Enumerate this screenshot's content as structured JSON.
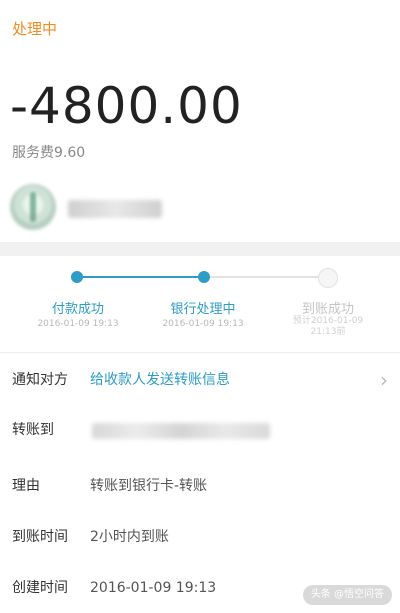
{
  "header": {
    "status": "处理中"
  },
  "amount": {
    "value": "-4800.00",
    "fee": "服务费9.60"
  },
  "progress": {
    "steps": [
      {
        "label": "付款成功",
        "time": "2016-01-09 19:13",
        "state": "done"
      },
      {
        "label": "银行处理中",
        "time": "2016-01-09 19:13",
        "state": "current"
      },
      {
        "label": "到账成功",
        "time": "预计2016-01-09\n21:13前",
        "state": "pending"
      }
    ]
  },
  "details": {
    "notify": {
      "label": "通知对方",
      "value": "给收款人发送转账信息"
    },
    "transfer_to": {
      "label": "转账到"
    },
    "reason": {
      "label": "理由",
      "value": "转账到银行卡-转账"
    },
    "arrival_time": {
      "label": "到账时间",
      "value": "2小时内到账"
    },
    "created_time": {
      "label": "创建时间",
      "value": "2016-01-09 19:13"
    }
  },
  "watermark": "头条 @悟空问答",
  "colors": {
    "accent": "#2d9cc6",
    "status": "#f08c22"
  },
  "icons": {
    "notify_chevron": "chevron-right-icon"
  }
}
